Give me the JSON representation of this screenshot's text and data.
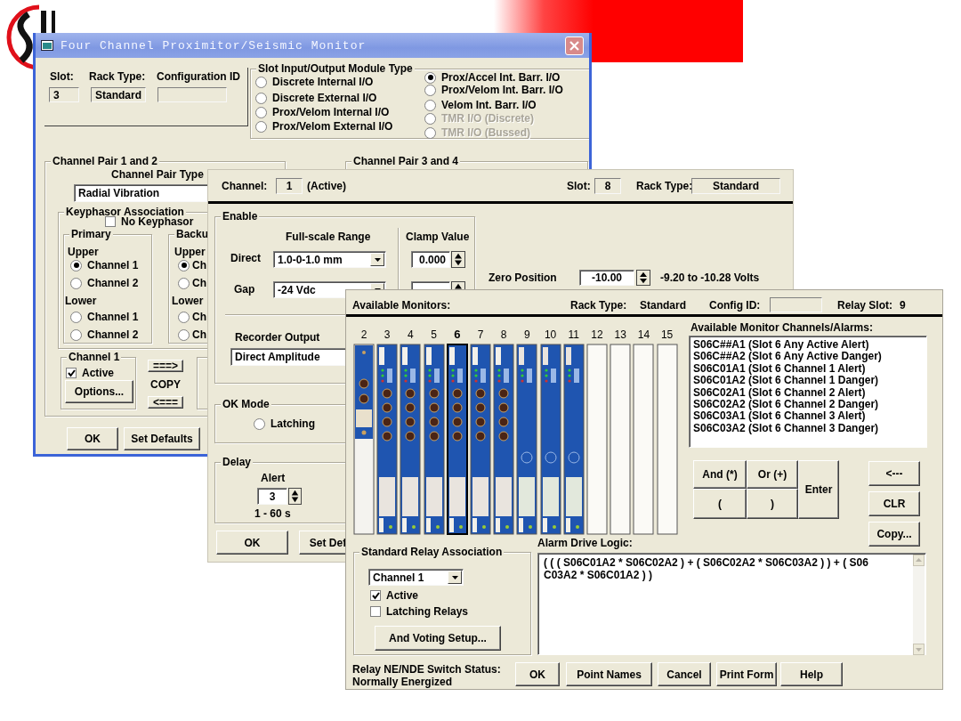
{
  "monitor_window": {
    "title": "Four Channel Proximitor/Seismic Monitor",
    "slot_label": "Slot:",
    "slot": "3",
    "rack_type_label": "Rack Type:",
    "rack_type": "Standard",
    "config_id_label": "Configuration ID",
    "io_module": {
      "title": "Slot Input/Output Module Type",
      "options": [
        {
          "label": "Discrete Internal I/O",
          "selected": false,
          "disabled": false
        },
        {
          "label": "Discrete External I/O",
          "selected": false,
          "disabled": false
        },
        {
          "label": "Prox/Velom Internal I/O",
          "selected": false,
          "disabled": false
        },
        {
          "label": "Prox/Velom External I/O",
          "selected": false,
          "disabled": false
        },
        {
          "label": "Prox/Accel Int. Barr. I/O",
          "selected": true,
          "disabled": false
        },
        {
          "label": "Prox/Velom Int. Barr. I/O",
          "selected": false,
          "disabled": false
        },
        {
          "label": "Velom Int. Barr. I/O",
          "selected": false,
          "disabled": false
        },
        {
          "label": "TMR I/O (Discrete)",
          "selected": false,
          "disabled": true
        },
        {
          "label": "TMR I/O (Bussed)",
          "selected": false,
          "disabled": true
        }
      ]
    },
    "pair_1_2": {
      "title": "Channel Pair 1 and 2",
      "type_label": "Channel Pair Type",
      "type_value": "Radial Vibration",
      "keyphasor": {
        "title": "Keyphasor Association",
        "no_keyphasor": {
          "label": "No Keyphasor",
          "checked": false
        },
        "primary": {
          "title": "Primary",
          "upper_label": "Upper",
          "upper": [
            {
              "label": "Channel 1",
              "selected": true
            },
            {
              "label": "Channel 2",
              "selected": false
            }
          ],
          "lower_label": "Lower",
          "lower": [
            {
              "label": "Channel 1",
              "selected": false
            },
            {
              "label": "Channel 2",
              "selected": false
            }
          ]
        },
        "backup": {
          "title": "Backu",
          "upper_label": "Upper",
          "upper": [
            {
              "label": "Ch",
              "selected": true
            },
            {
              "label": "Ch",
              "selected": false
            }
          ],
          "lower_label": "Lower",
          "lower": [
            {
              "label": "Ch",
              "selected": false
            },
            {
              "label": "Ch",
              "selected": false
            }
          ]
        }
      },
      "channel_1": {
        "title": "Channel 1",
        "active": {
          "label": "Active",
          "checked": true
        },
        "options_button": "Options..."
      },
      "copy_right_button": "===>",
      "copy_label": "COPY",
      "copy_left_button": "<==="
    },
    "pair_3_4": {
      "title": "Channel Pair 3 and 4"
    },
    "buttons": [
      "OK",
      "Set Defaults"
    ]
  },
  "channel_window": {
    "channel_label": "Channel:",
    "channel": "1",
    "channel_status": "(Active)",
    "slot_label": "Slot:",
    "slot": "8",
    "rack_type_label": "Rack Type:",
    "rack_type": "Standard",
    "enable": {
      "title": "Enable",
      "range_title": "Full-scale Range",
      "clamp_title": "Clamp Value",
      "rows": [
        {
          "label": "Direct",
          "range": "1.0-0-1.0 mm",
          "clamp": "0.000"
        },
        {
          "label": "Gap",
          "range": "-24 Vdc"
        }
      ]
    },
    "zero_position": {
      "label": "Zero Position",
      "value": "-10.00",
      "range": "-9.20 to -10.28 Volts"
    },
    "recorder_output": {
      "label": "Recorder Output",
      "value": "Direct Amplitude"
    },
    "ok_mode": {
      "title": "OK Mode",
      "latching": {
        "label": "Latching",
        "selected": false
      }
    },
    "delay": {
      "title": "Delay",
      "alert_label": "Alert",
      "alert": "3",
      "range": "1 - 60 s"
    },
    "buttons": [
      "OK",
      "Set Def"
    ]
  },
  "relay_window": {
    "available_monitors_label": "Available Monitors:",
    "rack_type_label": "Rack Type:",
    "rack_type": "Standard",
    "config_id_label": "Config ID:",
    "relay_slot_label": "Relay Slot:",
    "relay_slot": "9",
    "slots": [
      {
        "number": "2",
        "kind": "power",
        "selected": false
      },
      {
        "number": "3",
        "kind": "monitor",
        "selected": false
      },
      {
        "number": "4",
        "kind": "monitor",
        "selected": false
      },
      {
        "number": "5",
        "kind": "monitor",
        "selected": false
      },
      {
        "number": "6",
        "kind": "monitor",
        "selected": true
      },
      {
        "number": "7",
        "kind": "monitor",
        "selected": false
      },
      {
        "number": "8",
        "kind": "monitor",
        "selected": false
      },
      {
        "number": "9",
        "kind": "relay",
        "selected": false
      },
      {
        "number": "10",
        "kind": "relay",
        "selected": false
      },
      {
        "number": "11",
        "kind": "relay",
        "selected": false
      },
      {
        "number": "12",
        "kind": "empty",
        "selected": false
      },
      {
        "number": "13",
        "kind": "empty",
        "selected": false
      },
      {
        "number": "14",
        "kind": "empty",
        "selected": false
      },
      {
        "number": "15",
        "kind": "empty",
        "selected": false
      }
    ],
    "channels_label": "Available Monitor Channels/Alarms:",
    "channels": [
      "S06C##A1 (Slot 6 Any Active Alert)",
      "S06C##A2 (Slot 6 Any Active Danger)",
      "S06C01A1 (Slot 6 Channel 1 Alert)",
      "S06C01A2 (Slot 6 Channel 1 Danger)",
      "S06C02A1 (Slot 6 Channel 2 Alert)",
      "S06C02A2 (Slot 6 Channel 2 Danger)",
      "S06C03A1 (Slot 6 Channel 3 Alert)",
      "S06C03A2 (Slot 6 Channel 3 Danger)"
    ],
    "logic_buttons": [
      "And (*)",
      "Or (+)",
      "(",
      ")",
      "Enter"
    ],
    "side_buttons": [
      "<---",
      "CLR",
      "Copy..."
    ],
    "relay_association": {
      "title": "Standard Relay Association",
      "channel": "Channel 1",
      "active": {
        "label": "Active",
        "checked": true
      },
      "latching": {
        "label": "Latching Relays",
        "checked": false
      },
      "voting_button": "And Voting Setup..."
    },
    "logic_label": "Alarm Drive Logic:",
    "logic_lines": [
      "( ( ( S06C01A2 * S06C02A2 ) + ( S06C02A2 * S06C03A2 ) ) + ( S06",
      "C03A2 * S06C01A2 ) )"
    ],
    "switch_status_label": "Relay NE/NDE Switch Status:",
    "switch_status": "Normally Energized",
    "buttons": [
      "OK",
      "Point Names",
      "Cancel",
      "Print Form",
      "Help"
    ]
  }
}
